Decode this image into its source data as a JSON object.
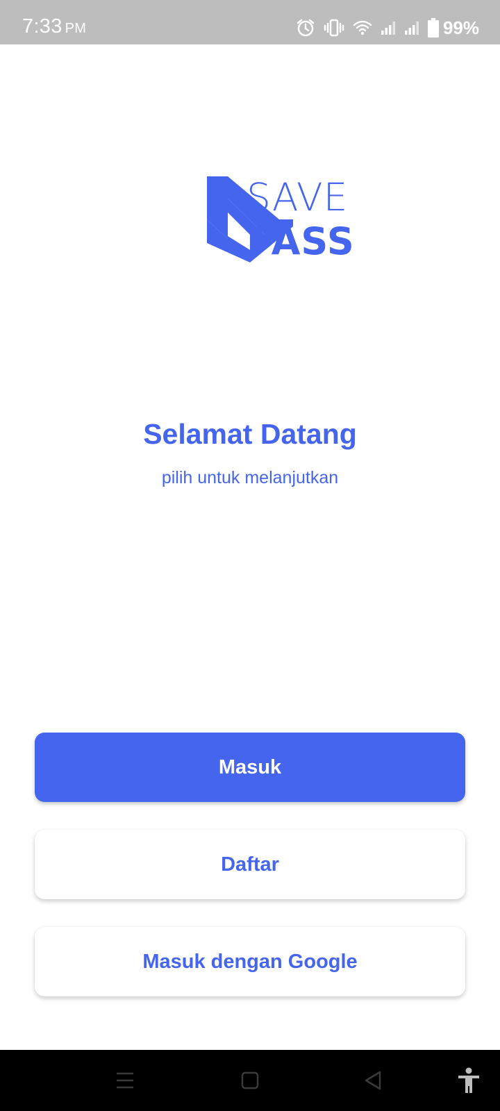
{
  "status_bar": {
    "time": "7:33",
    "ampm": "PM",
    "battery_percent": "99%",
    "icons": [
      "alarm-icon",
      "vibrate-icon",
      "wifi-icon",
      "signal-icon",
      "signal-icon",
      "battery-icon"
    ]
  },
  "logo": {
    "word_top": "SAVE",
    "word_bottom": "PASS",
    "color": "#4565ee"
  },
  "welcome": {
    "title": "Selamat Datang",
    "subtitle": "pilih untuk melanjutkan"
  },
  "buttons": {
    "login": "Masuk",
    "register": "Daftar",
    "google_login": "Masuk dengan Google"
  },
  "nav_bar": {
    "icons": [
      "menu-icon",
      "home-icon",
      "back-icon",
      "accessibility-icon"
    ]
  },
  "colors": {
    "accent": "#4565ee",
    "status_bar": "#bdbdbd",
    "nav_bar": "#000000"
  }
}
